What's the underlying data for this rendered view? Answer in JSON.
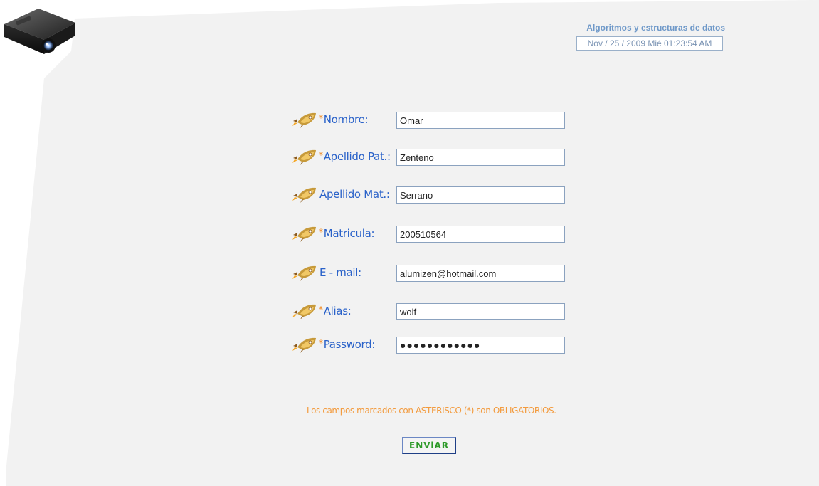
{
  "header": {
    "title": "Algoritmos y estructuras de datos",
    "datetime": "Nov / 25 / 2009 Mié 01:23:54 AM"
  },
  "form": {
    "fields": [
      {
        "required_mark": "*",
        "label": "Nombre:",
        "value": "Omar"
      },
      {
        "required_mark": "*",
        "label": "Apellido Pat.:",
        "value": "Zenteno"
      },
      {
        "required_mark": "",
        "label": "Apellido Mat.:",
        "value": "Serrano"
      },
      {
        "required_mark": "*",
        "label": "Matricula:",
        "value": "200510564"
      },
      {
        "required_mark": "",
        "label": "E - mail:",
        "value": "alumizen@hotmail.com"
      },
      {
        "required_mark": "*",
        "label": "Alias:",
        "value": "wolf"
      },
      {
        "required_mark": "*",
        "label": "Password:",
        "value": "●●●●●●●●●●●●"
      }
    ],
    "notice": "Los campos marcados con ASTERISCO (*) son OBLIGATORIOS.",
    "submit_label": "ENViAR"
  },
  "icons": {
    "logo": "projector-icon",
    "field_bullet": "rocket-icon"
  },
  "colors": {
    "label": "#2a62c9",
    "required": "#f08a24",
    "notice": "#f39a3c",
    "submit_text": "#2e9a2a",
    "header": "#6f99c9",
    "background_panel": "#f2f2f2"
  }
}
